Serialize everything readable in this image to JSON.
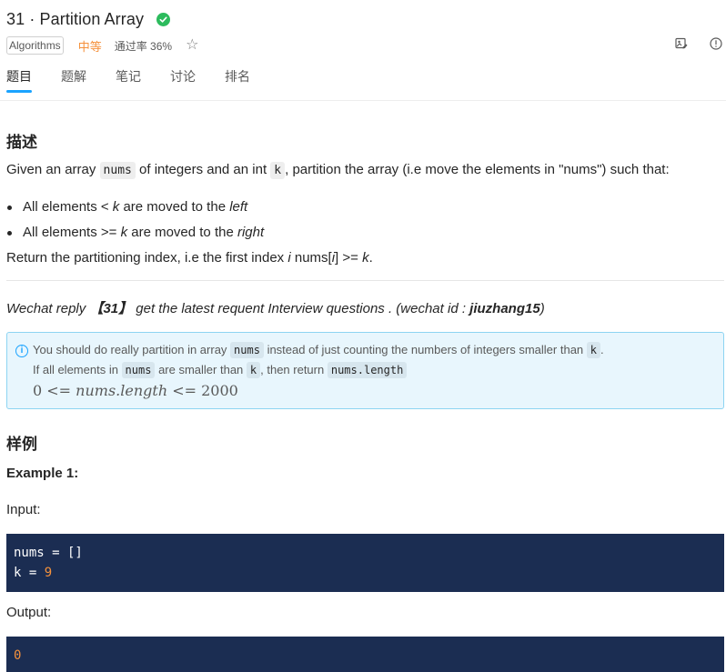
{
  "problem": {
    "title": "31 · Partition Array",
    "tag": "Algorithms",
    "difficulty": "中等",
    "acceptance": "通过率 36%"
  },
  "tabs": [
    "题目",
    "题解",
    "笔记",
    "讨论",
    "排名"
  ],
  "description": {
    "heading": "描述",
    "intro_1": "Given an array ",
    "intro_code_1": "nums",
    "intro_2": " of integers and an int ",
    "intro_code_2": "k",
    "intro_3": ", partition the array (i.e move the elements in \"nums\") such that:",
    "bullet_1_a": "All elements < ",
    "bullet_1_k": "k",
    "bullet_1_b": " are moved to the ",
    "bullet_1_c": "left",
    "bullet_2_a": "All elements >= ",
    "bullet_2_k": "k",
    "bullet_2_b": " are moved to the ",
    "bullet_2_c": "right",
    "return_a": "Return the partitioning index, i.e the first index ",
    "return_i": "i",
    "return_b": " nums[",
    "return_i2": "i",
    "return_c": "] >= ",
    "return_k": "k",
    "return_d": "."
  },
  "wechat": {
    "prefix": "Wechat reply ",
    "code": "【31】",
    "middle": " get the latest requent Interview questions . (wechat id : ",
    "id": "jiuzhang15",
    "suffix": ")"
  },
  "notice": {
    "line1_a": "You should do really partition in array ",
    "line1_code": "nums",
    "line1_b": " instead of just counting the numbers of integers smaller than ",
    "line1_code2": "k",
    "line1_c": ".",
    "line2_a": "If all elements in ",
    "line2_code": "nums",
    "line2_b": " are smaller than ",
    "line2_code2": "k",
    "line2_c": ", then return ",
    "line2_code3": "nums.length",
    "math_a": "0 <= ",
    "math_var": "nums.length",
    "math_b": " <= 2000"
  },
  "examples": {
    "heading": "样例",
    "example1_title": "Example 1:",
    "input_label": "Input:",
    "input_line1": "nums = []",
    "input_line2_a": "k = ",
    "input_line2_b": "9",
    "output_label": "Output:",
    "output_value": "0"
  },
  "colors": {
    "accent": "#1aa3ff",
    "solved": "#2cbb5d",
    "difficulty": "#f5913c",
    "code_bg": "#1b2d52"
  },
  "icons": [
    "check-icon",
    "star-icon",
    "image-edit-icon",
    "info-circle-icon"
  ]
}
